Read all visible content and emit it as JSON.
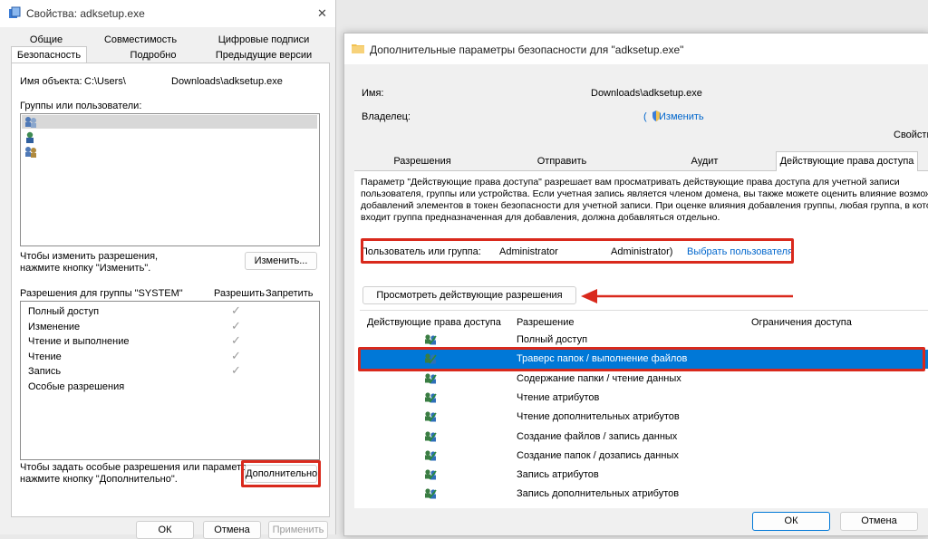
{
  "left": {
    "title": "Свойства: adksetup.exe",
    "close": "✕",
    "tabs_row1": [
      "Общие",
      "Совместимость",
      "Цифровые подписи"
    ],
    "tabs_row2": [
      "Безопасность",
      "Подробно",
      "Предыдущие версии"
    ],
    "object_label": "Имя объекта:",
    "object_value_a": "C:\\Users\\",
    "object_value_b": "Downloads\\adksetup.exe",
    "groups_label": "Группы или пользователи:",
    "change_hint": "Чтобы изменить разрешения,\nнажмите кнопку \"Изменить\".",
    "change_button": "Изменить...",
    "perm_header": "Разрешения для группы \"SYSTEM\"",
    "allow_col": "Разрешить",
    "deny_col": "Запретить",
    "permissions": [
      {
        "name": "Полный доступ",
        "check": "✓"
      },
      {
        "name": "Изменение",
        "check": "✓"
      },
      {
        "name": "Чтение и выполнение",
        "check": "✓"
      },
      {
        "name": "Чтение",
        "check": "✓"
      },
      {
        "name": "Запись",
        "check": "✓"
      },
      {
        "name": "Особые разрешения",
        "check": ""
      }
    ],
    "special_hint": "Чтобы задать особые разрешения или параметры,\nнажмите кнопку \"Дополнительно\".",
    "advanced_button": "Дополнительно",
    "ok": "ОК",
    "cancel": "Отмена",
    "apply": "Применить"
  },
  "right": {
    "title": "Дополнительные параметры безопасности  для \"adksetup.exe\"",
    "name_label": "Имя:",
    "name_value": "Downloads\\adksetup.exe",
    "owner_label": "Владелец:",
    "owner_value": "(",
    "change_link": "Изменить",
    "cut_text": "Свойств",
    "tabs": [
      "Разрешения",
      "Отправить",
      "Аудит",
      "Действующие права доступа"
    ],
    "description": "Параметр \"Действующие права доступа\" разрешает вам просматривать действующие права доступа для учетной записи пользователя, группы или устройства. Если учетная запись является членом домена, вы также можете оценить влияние возможных добавлений элементов в токен безопасности для учетной записи. При оценке влияния добавления группы, любая группа, в которую входит группа предназначенная для добавления, должна добавляться отдельно.",
    "user_label": "Пользователь или группа:",
    "user_value_a": "Administrator",
    "user_value_b": "Administrator)",
    "select_user_link": "Выбрать пользователя",
    "view_button": "Просмотреть действующие разрешения",
    "columns": [
      "Действующие права доступа",
      "Разрешение",
      "Ограничения доступа"
    ],
    "rows": [
      "Полный доступ",
      "Траверс папок / выполнение файлов",
      "Содержание папки / чтение данных",
      "Чтение атрибутов",
      "Чтение дополнительных атрибутов",
      "Создание файлов / запись данных",
      "Создание папок / дозапись данных",
      "Запись атрибутов",
      "Запись дополнительных атрибутов"
    ],
    "ok": "ОК",
    "cancel": "Отмена"
  },
  "colors": {
    "highlight": "#d9291c",
    "selection": "#0078d7",
    "link": "#0066cc"
  }
}
